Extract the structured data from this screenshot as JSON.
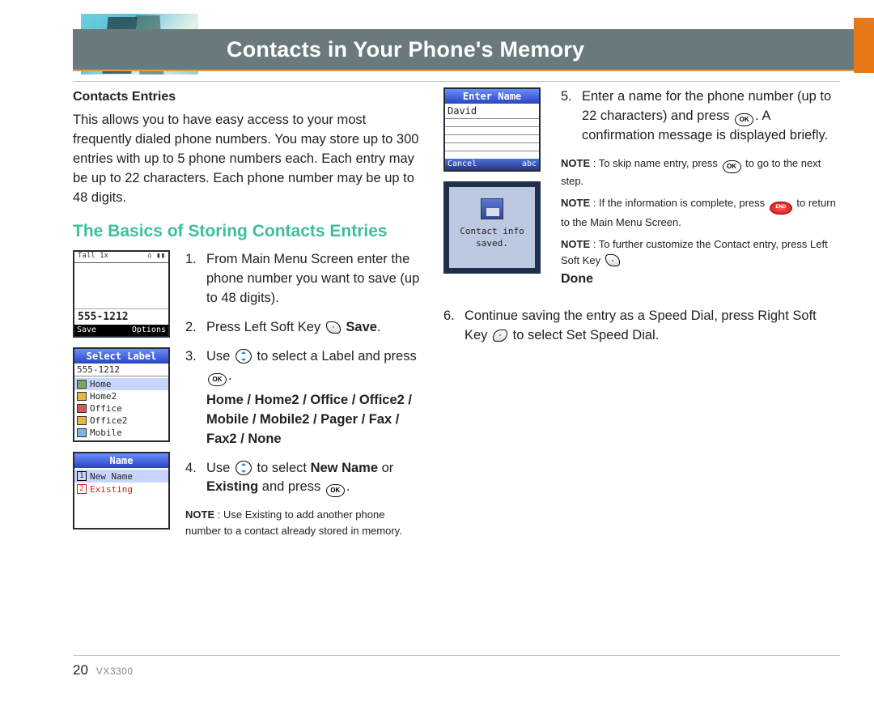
{
  "header": {
    "title": "Contacts in Your Phone's Memory"
  },
  "sec1": {
    "heading": "Contacts Entries",
    "para": "This allows you to have easy access to your most frequently dialed phone numbers. You may store up to 300 entries with up to 5 phone numbers each. Each entry may be up to 22 characters. Each phone number may be up to 48 digits."
  },
  "h2": "The Basics of Storing Contacts Entries",
  "steps": {
    "s1": {
      "n": "1.",
      "t": "From Main Menu Screen enter the phone number you want to save (up to 48 digits)."
    },
    "s2": {
      "n": "2.",
      "pre": "Press Left Soft Key ",
      "post": " ",
      "bold": "Save",
      "end": "."
    },
    "s3": {
      "n": "3.",
      "a": "Use ",
      "b": " to select a Label and press ",
      "c": ".",
      "labels": "Home / Home2 / Office / Office2 / Mobile / Mobile2 / Pager / Fax / Fax2 / None"
    },
    "s4": {
      "n": "4.",
      "a": "Use ",
      "b": " to select ",
      "bold1": "New Name",
      "mid": " or ",
      "bold2": "Existing",
      "c": " and press ",
      "d": "."
    },
    "note4": {
      "label": "NOTE",
      "sep": " : ",
      "t": "Use Existing to add another phone number to a contact already stored in memory."
    },
    "s5": {
      "n": "5.",
      "a": "Enter a name for the phone number (up to 22 characters) and press ",
      "b": ". A confirmation message is displayed briefly."
    },
    "note5a": {
      "label": "NOTE",
      "sep": " : ",
      "a": "To skip name entry, press ",
      "b": " to go to the next step."
    },
    "note5b": {
      "label": "NOTE",
      "sep": " : ",
      "a": "If the information is complete, press ",
      "b": " to return to the Main Menu Screen."
    },
    "note5c": {
      "label": "NOTE",
      "sep": " : ",
      "a": "To further customize the Contact entry, press Left Soft Key ",
      "done": "Done",
      "end": "."
    },
    "s6": {
      "n": "6.",
      "a": "Continue saving the entry as a Speed Dial, press Right Soft Key ",
      "b": " to select Set Speed Dial."
    }
  },
  "icons": {
    "ok": "OK",
    "end": "END"
  },
  "phones": {
    "dial": {
      "status_l": "Tall   1x",
      "status_r": "⌂  ▮▮",
      "num": "555-1212",
      "left": "Save",
      "right": "Options"
    },
    "label": {
      "title": "Select Label",
      "num": "555-1212",
      "items": [
        "Home",
        "Home2",
        "Office",
        "Office2",
        "Mobile"
      ]
    },
    "name": {
      "title": "Name",
      "i1": "New Name",
      "i2": "Existing"
    },
    "enter": {
      "title": "Enter Name",
      "val": "David",
      "left": "Cancel",
      "right": "abc"
    },
    "saved": {
      "line1": "Contact info",
      "line2": "saved."
    }
  },
  "footer": {
    "page": "20",
    "model": "VX3300"
  }
}
